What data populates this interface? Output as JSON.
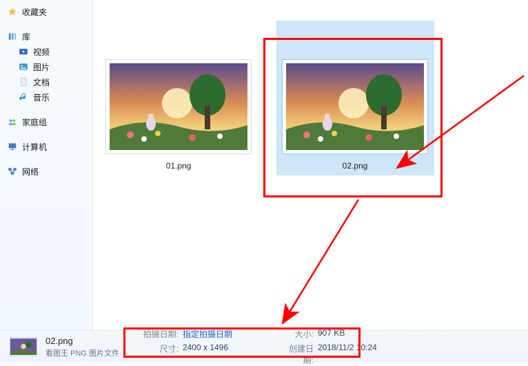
{
  "sidebar": {
    "favorites": "收藏夹",
    "libraries": "库",
    "videos": "视频",
    "pictures": "图片",
    "documents": "文档",
    "music": "音乐",
    "homegroup": "家庭组",
    "computer": "计算机",
    "network": "网络"
  },
  "files": {
    "a": {
      "label": "01.png"
    },
    "b": {
      "label": "02.png"
    }
  },
  "status": {
    "filename": "02.png",
    "filetype": "看图王 PNG 图片文件",
    "shotdate_k": "拍摄日期:",
    "shotdate_v": "指定拍摄日期",
    "dims_k": "尺寸:",
    "dims_v": "2400 x 1496",
    "size_k": "大小:",
    "size_v": "907 KB",
    "created_k": "创建日期:",
    "created_v": "2018/11/2 10:24"
  }
}
